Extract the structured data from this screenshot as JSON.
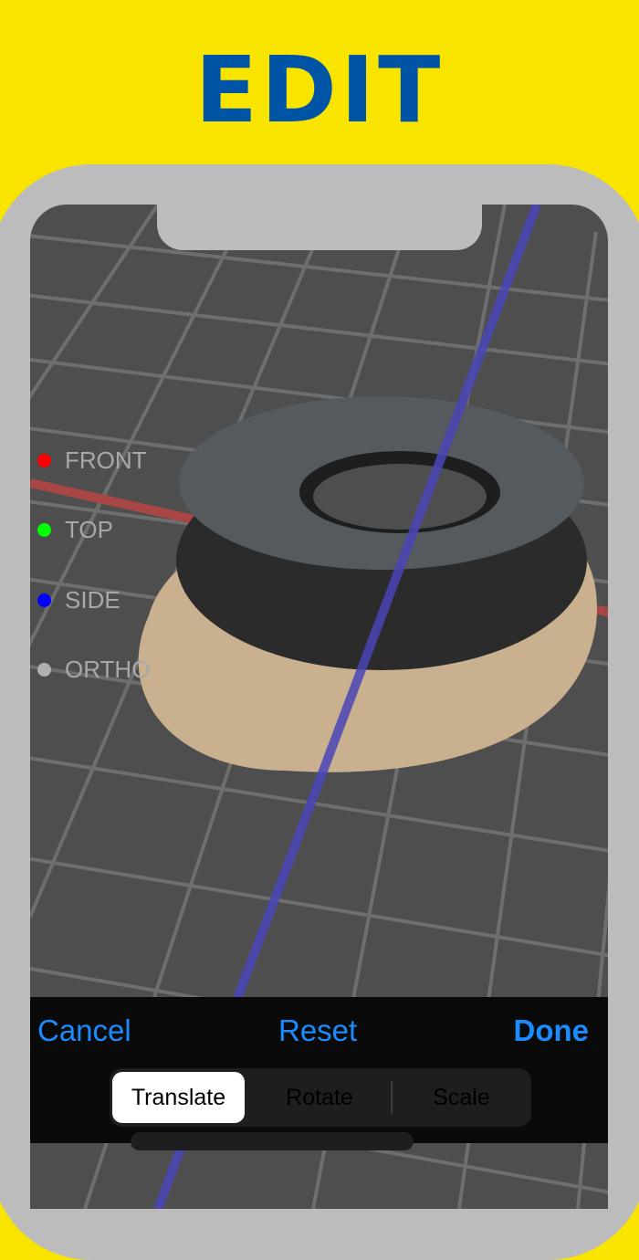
{
  "banner": {
    "title": "EDIT"
  },
  "view_buttons": [
    {
      "label": "FRONT",
      "color": "#ff0000"
    },
    {
      "label": "TOP",
      "color": "#00ff00"
    },
    {
      "label": "SIDE",
      "color": "#0000ff"
    },
    {
      "label": "ORTHO",
      "color": "#b0b0b0"
    }
  ],
  "toolbar": {
    "cancel": "Cancel",
    "reset": "Reset",
    "done": "Done"
  },
  "segments": {
    "items": [
      "Translate",
      "Rotate",
      "Scale"
    ],
    "selected": "Translate"
  },
  "colors": {
    "accent": "#1a8cff",
    "banner_bg": "#f9e400",
    "banner_text": "#0054a6"
  }
}
